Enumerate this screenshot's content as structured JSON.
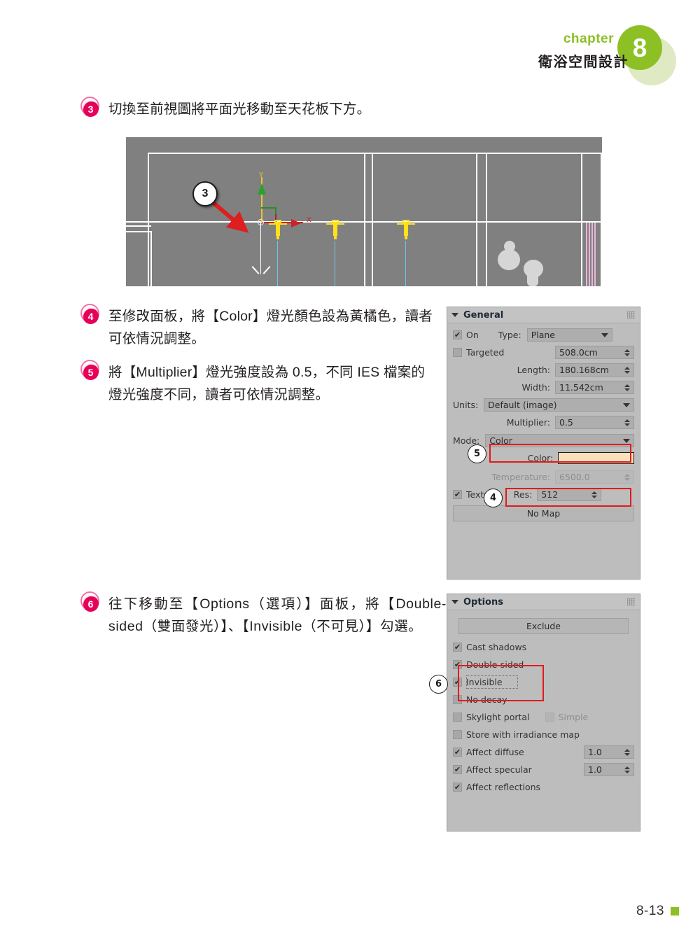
{
  "header": {
    "chapter_word": "chapter",
    "chapter_number": "8",
    "chapter_title": "衛浴空間設計"
  },
  "footer": {
    "page_number": "8-13"
  },
  "steps": [
    {
      "num": "3",
      "text": "切換至前視圖將平面光移動至天花板下方。"
    },
    {
      "num": "4",
      "text": "至修改面板，將【Color】燈光顏色設為黃橘色，讀者可依情況調整。"
    },
    {
      "num": "5",
      "text": "將【Multiplier】燈光強度設為 0.5，不同 IES 檔案的燈光強度不同，讀者可依情況調整。"
    },
    {
      "num": "6",
      "text": "往下移動至【Options（選項）】面板，將【Double-sided（雙面發光）】、【Invisible（不可見）】勾選。"
    }
  ],
  "viewport": {
    "callout_label": "3",
    "axis_y_label": "Y",
    "axis_x_label": "X"
  },
  "general_panel": {
    "title": "General",
    "on_label": "On",
    "on_checked": "✔",
    "type_label": "Type:",
    "type_value": "Plane",
    "targeted_label": "Targeted",
    "targeted_checked": "",
    "targeted_value": "508.0cm",
    "length_label": "Length:",
    "length_value": "180.168cm",
    "width_label": "Width:",
    "width_value": "11.542cm",
    "units_label": "Units:",
    "units_value": "Default (image)",
    "multiplier_label": "Multiplier:",
    "multiplier_value": "0.5",
    "mode_label": "Mode:",
    "mode_value": "Color",
    "color_label": "Color:",
    "color_value": "#fbe0bb",
    "temperature_label": "Temperature:",
    "temperature_value": "6500.0",
    "texture_label": "Texture",
    "texture_checked": "✔",
    "res_label": "Res:",
    "res_value": "512",
    "no_map_label": "No Map",
    "callout_multiplier": "5",
    "callout_color": "4"
  },
  "options_panel": {
    "title": "Options",
    "exclude_label": "Exclude",
    "callout": "6",
    "items": [
      {
        "label": "Cast shadows",
        "checked": "✔",
        "value": ""
      },
      {
        "label": "Double-sided",
        "checked": "✔",
        "value": ""
      },
      {
        "label": "Invisible",
        "checked": "✔",
        "value": ""
      },
      {
        "label": "No decay",
        "checked": "",
        "value": ""
      },
      {
        "label": "Skylight portal",
        "checked": "",
        "value": ""
      },
      {
        "label": "Simple",
        "checked": "",
        "value": ""
      },
      {
        "label": "Store with irradiance map",
        "checked": "",
        "value": ""
      },
      {
        "label": "Affect diffuse",
        "checked": "✔",
        "value": "1.0"
      },
      {
        "label": "Affect specular",
        "checked": "✔",
        "value": "1.0"
      },
      {
        "label": "Affect reflections",
        "checked": "✔",
        "value": ""
      }
    ]
  },
  "colors": {
    "accent_green": "#8cc025",
    "step_pink": "#e6005a",
    "highlight_red": "#e01b1b",
    "panel_gray": "#bdbdbd",
    "viewport_gray": "#808080"
  }
}
